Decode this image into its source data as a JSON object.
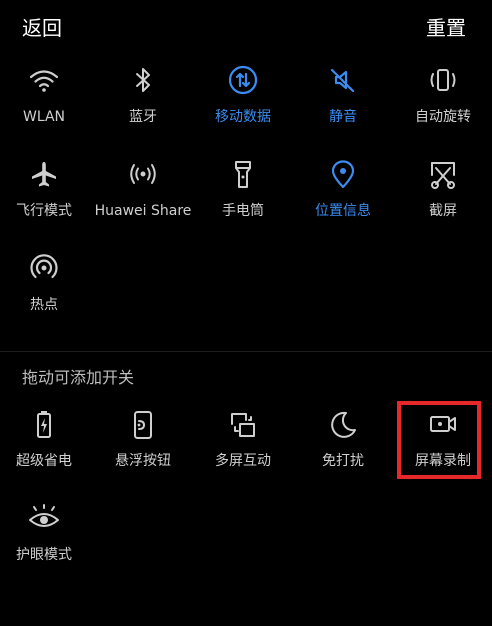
{
  "header": {
    "back_label": "返回",
    "reset_label": "重置"
  },
  "active_tiles": [
    {
      "id": "wlan",
      "label": "WLAN",
      "icon": "wifi-icon",
      "active": false
    },
    {
      "id": "bluetooth",
      "label": "蓝牙",
      "icon": "bluetooth-icon",
      "active": false
    },
    {
      "id": "mobile-data",
      "label": "移动数据",
      "icon": "mobile-data-icon",
      "active": true
    },
    {
      "id": "mute",
      "label": "静音",
      "icon": "mute-icon",
      "active": true
    },
    {
      "id": "auto-rotate",
      "label": "自动旋转",
      "icon": "auto-rotate-icon",
      "active": false
    },
    {
      "id": "airplane",
      "label": "飞行模式",
      "icon": "airplane-icon",
      "active": false
    },
    {
      "id": "huawei-share",
      "label": "Huawei Share",
      "icon": "huawei-share-icon",
      "active": false
    },
    {
      "id": "flashlight",
      "label": "手电筒",
      "icon": "flashlight-icon",
      "active": false
    },
    {
      "id": "location",
      "label": "位置信息",
      "icon": "location-icon",
      "active": true
    },
    {
      "id": "screenshot",
      "label": "截屏",
      "icon": "screenshot-icon",
      "active": false
    },
    {
      "id": "hotspot",
      "label": "热点",
      "icon": "hotspot-icon",
      "active": false
    }
  ],
  "add_section": {
    "title": "拖动可添加开关"
  },
  "available_tiles": [
    {
      "id": "super-power-saving",
      "label": "超级省电",
      "icon": "battery-icon"
    },
    {
      "id": "floating-button",
      "label": "悬浮按钮",
      "icon": "floating-button-icon"
    },
    {
      "id": "multi-screen",
      "label": "多屏互动",
      "icon": "multi-screen-icon"
    },
    {
      "id": "do-not-disturb",
      "label": "免打扰",
      "icon": "moon-icon"
    },
    {
      "id": "screen-record",
      "label": "屏幕录制",
      "icon": "screen-record-icon"
    },
    {
      "id": "eye-comfort",
      "label": "护眼模式",
      "icon": "eye-icon"
    }
  ],
  "colors": {
    "background": "#000000",
    "text": "#cfcfcf",
    "active": "#3b8cf0",
    "highlight": "#e6282b"
  }
}
